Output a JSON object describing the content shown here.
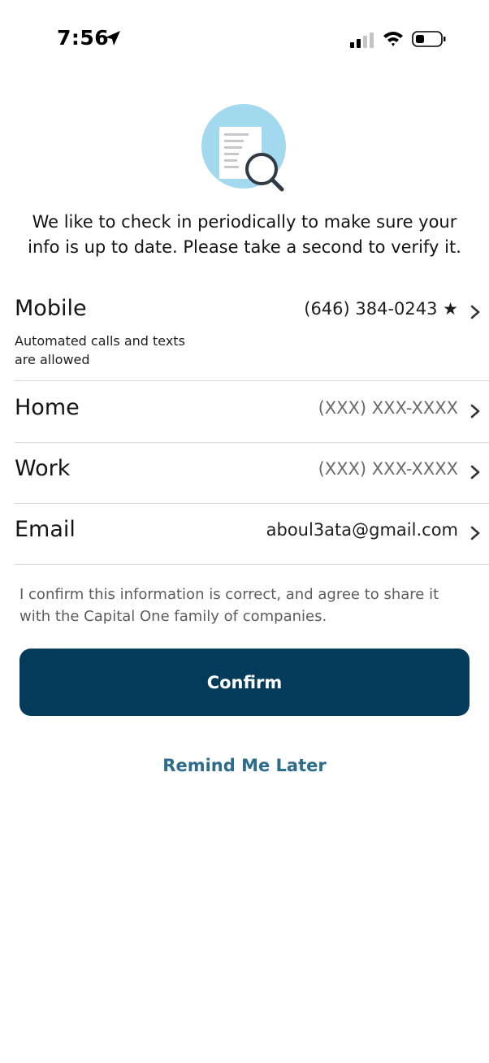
{
  "status_bar": {
    "time": "7:56",
    "location_icon": "location-arrow-icon",
    "signal_icon": "cellular-signal-icon",
    "wifi_icon": "wifi-icon",
    "battery_icon": "battery-low-icon"
  },
  "hero": {
    "icon": "document-search-icon",
    "circle_color": "#a3d9ef"
  },
  "intro_text": "We like to check in periodically to make sure your info is up to date. Please take a second to verify it.",
  "contacts": [
    {
      "label": "Mobile",
      "value": "(646) 384-0243 ★",
      "subtext": "Automated calls and texts are allowed",
      "is_placeholder": false
    },
    {
      "label": "Home",
      "value": "(XXX) XXX-XXXX",
      "is_placeholder": true
    },
    {
      "label": "Work",
      "value": "(XXX) XXX-XXXX",
      "is_placeholder": true
    },
    {
      "label": "Email",
      "value": "aboul3ata@gmail.com",
      "is_placeholder": false
    }
  ],
  "consent_text": "I confirm this information is correct, and agree to share it with the Capital One family of companies.",
  "confirm_label": "Confirm",
  "remind_label": "Remind Me Later",
  "colors": {
    "primary_button": "#043b5a",
    "link": "#2b6d8a",
    "divider": "#dcdcdc"
  }
}
